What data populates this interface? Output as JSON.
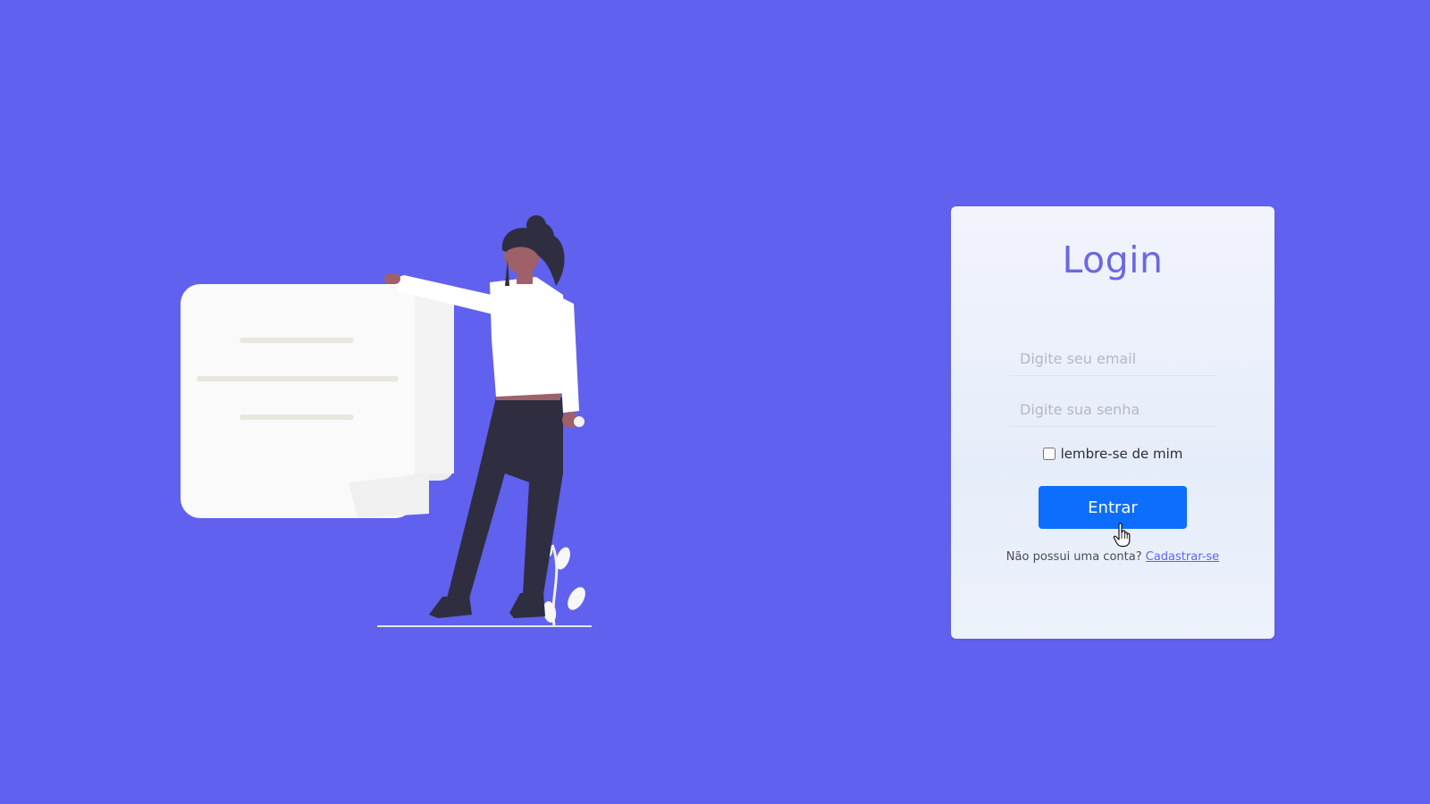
{
  "login_card": {
    "title": "Login",
    "email_placeholder": "Digite seu email",
    "password_placeholder": "Digite sua senha",
    "remember_label": "lembre-se de mim",
    "remember_checked": false,
    "submit_label": "Entrar",
    "signup_prompt": "Não possui uma conta?",
    "signup_link": "Cadastrar-se"
  },
  "colors": {
    "background": "#6061ee",
    "title": "#6b69e0",
    "button": "#0d6efd",
    "link": "#5a67f2"
  },
  "icons": {
    "illustration": "person-with-document-illustration",
    "cursor": "hand-pointer-cursor-icon"
  }
}
